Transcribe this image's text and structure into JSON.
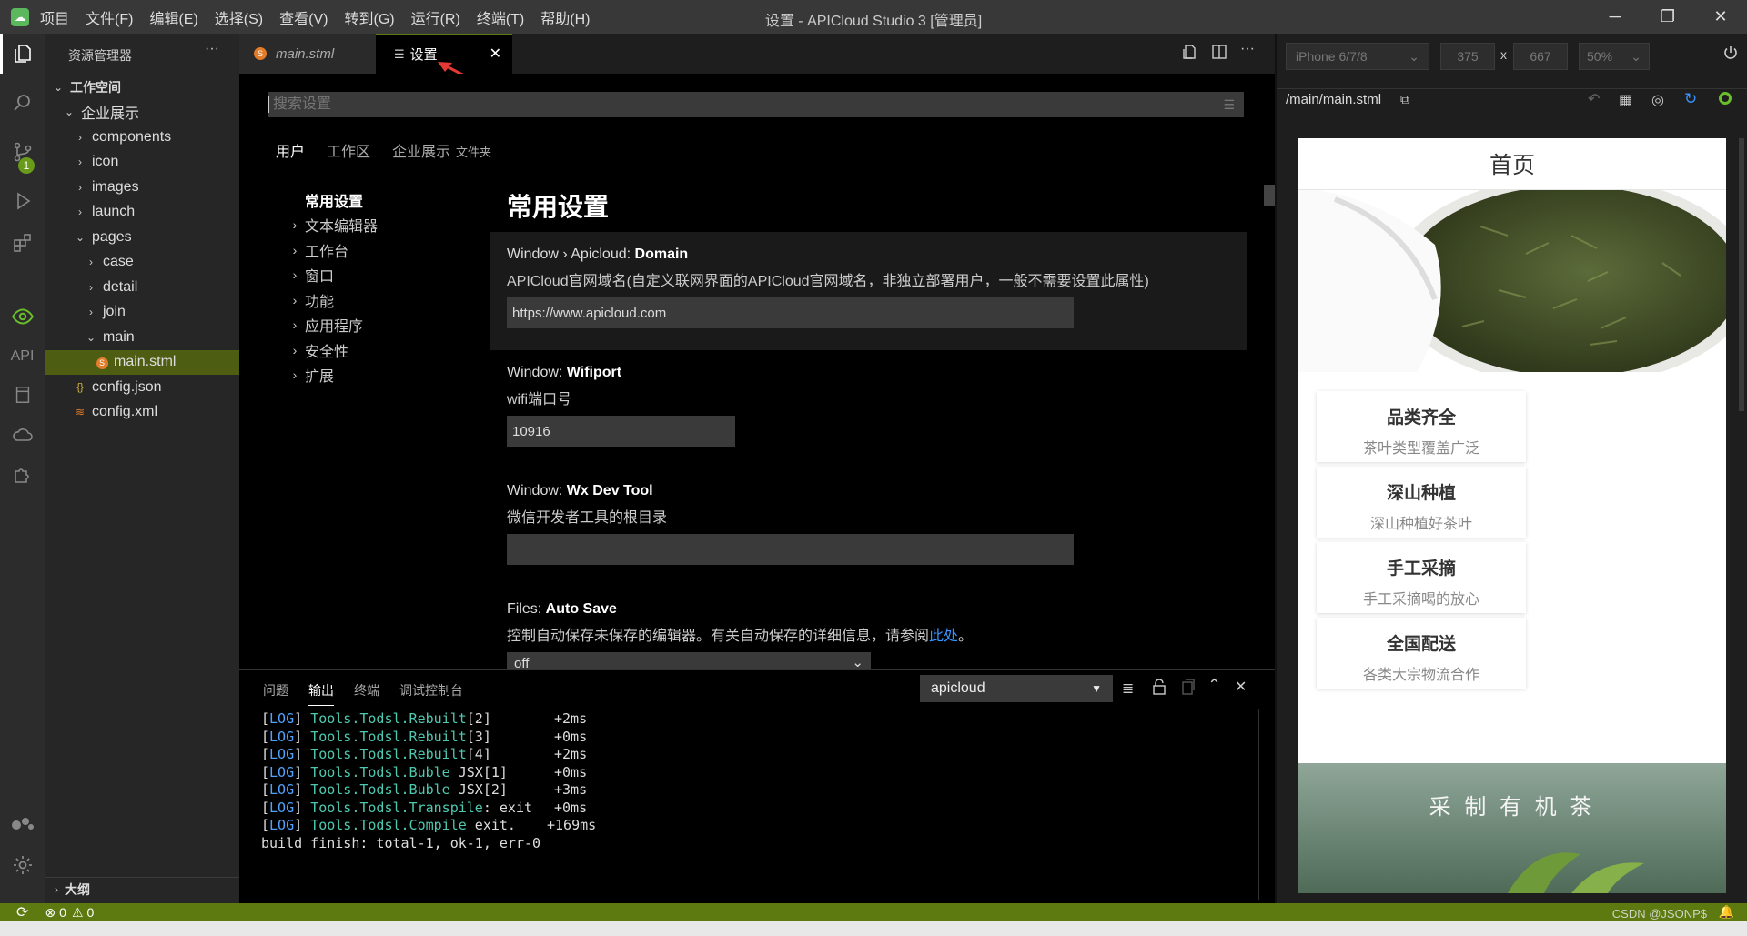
{
  "titlebar": {
    "menus": [
      "项目",
      "文件(F)",
      "编辑(E)",
      "选择(S)",
      "查看(V)",
      "转到(G)",
      "运行(R)",
      "终端(T)",
      "帮助(H)"
    ],
    "title": "设置 - APICloud Studio 3 [管理员]"
  },
  "activity": {
    "api_label": "API",
    "scm_badge": "1"
  },
  "sidebar": {
    "title": "资源管理器",
    "more": "···",
    "tree": [
      {
        "label": "工作空间",
        "depth": 0,
        "kind": "folder-open"
      },
      {
        "label": "企业展示",
        "depth": 1,
        "kind": "folder-open"
      },
      {
        "label": "components",
        "depth": 2,
        "kind": "folder"
      },
      {
        "label": "icon",
        "depth": 2,
        "kind": "folder"
      },
      {
        "label": "images",
        "depth": 2,
        "kind": "folder"
      },
      {
        "label": "launch",
        "depth": 2,
        "kind": "folder"
      },
      {
        "label": "pages",
        "depth": 2,
        "kind": "folder-open"
      },
      {
        "label": "case",
        "depth": 3,
        "kind": "folder"
      },
      {
        "label": "detail",
        "depth": 3,
        "kind": "folder"
      },
      {
        "label": "join",
        "depth": 3,
        "kind": "folder"
      },
      {
        "label": "main",
        "depth": 3,
        "kind": "folder-open"
      },
      {
        "label": "main.stml",
        "depth": 4,
        "kind": "stml",
        "selected": true
      },
      {
        "label": "config.json",
        "depth": 2,
        "kind": "json"
      },
      {
        "label": "config.xml",
        "depth": 2,
        "kind": "xml"
      }
    ],
    "outline": "大纲"
  },
  "tabs": [
    {
      "label": "main.stml",
      "active": false
    },
    {
      "label": "设置",
      "active": true
    }
  ],
  "settings": {
    "search_placeholder": "搜索设置",
    "scope_tabs": [
      "用户",
      "工作区",
      "企业展示"
    ],
    "scope_suffix": "文件夹",
    "toc": [
      "常用设置",
      "文本编辑器",
      "工作台",
      "窗口",
      "功能",
      "应用程序",
      "安全性",
      "扩展"
    ],
    "heading": "常用设置",
    "items": [
      {
        "prefix": "Window › Apicloud: ",
        "name": "Domain",
        "desc": "APICloud官网域名(自定义联网界面的APICloud官网域名，非独立部署用户，一般不需要设置此属性)",
        "value": "https://www.apicloud.com"
      },
      {
        "prefix": "Window: ",
        "name": "Wifiport",
        "desc": "wifi端口号",
        "value": "10916"
      },
      {
        "prefix": "Window: ",
        "name": "Wx Dev Tool",
        "desc": "微信开发者工具的根目录",
        "value": ""
      },
      {
        "prefix": "Files: ",
        "name": "Auto Save",
        "desc": "控制自动保存未保存的编辑器。有关自动保存的详细信息，请参阅",
        "link": "此处",
        "desc_end": "。",
        "value": "off"
      }
    ]
  },
  "panel": {
    "tabs": [
      "问题",
      "输出",
      "终端",
      "调试控制台"
    ],
    "active_tab": "输出",
    "channel": "apicloud",
    "logs": [
      {
        "tag": "LOG",
        "src": "Tools.Todsl.Rebuilt",
        "arg": "[2]",
        "time": "+2ms"
      },
      {
        "tag": "LOG",
        "src": "Tools.Todsl.Rebuilt",
        "arg": "[3]",
        "time": "+0ms"
      },
      {
        "tag": "LOG",
        "src": "Tools.Todsl.Rebuilt",
        "arg": "[4]",
        "time": "+2ms"
      },
      {
        "tag": "LOG",
        "src": "Tools.Todsl.Buble",
        "arg": " JSX[1]",
        "time": "+0ms"
      },
      {
        "tag": "LOG",
        "src": "Tools.Todsl.Buble",
        "arg": " JSX[2]",
        "time": "+3ms"
      },
      {
        "tag": "LOG",
        "src": "Tools.Todsl.Transpile",
        "arg": ": exit",
        "time": "+0ms"
      },
      {
        "tag": "LOG",
        "src": "Tools.Todsl.Compile",
        "arg": " exit.",
        "time": "+169ms"
      }
    ],
    "final": "build finish: total-1, ok-1, err-0"
  },
  "preview": {
    "device": "iPhone 6/7/8",
    "width": "375",
    "times": "x",
    "height": "667",
    "zoom": "50%",
    "path": "/main/main.stml",
    "page_title": "首页",
    "cards": [
      {
        "title": "品类齐全",
        "sub": "茶叶类型覆盖广泛"
      },
      {
        "title": "深山种植",
        "sub": "深山种植好茶叶"
      },
      {
        "title": "手工采摘",
        "sub": "手工采摘喝的放心"
      },
      {
        "title": "全国配送",
        "sub": "各类大宗物流合作"
      }
    ],
    "banner_text": "采 制 有 机 茶"
  },
  "status": {
    "errors": "0",
    "warnings": "0",
    "watermark": "CSDN @JSONP$"
  },
  "colors": {
    "accent": "#5c7a0f",
    "selected_row": "#4d5e12",
    "link": "#3794ff",
    "log_tag": "#4fa3ff",
    "log_src": "#4ec9b0"
  }
}
